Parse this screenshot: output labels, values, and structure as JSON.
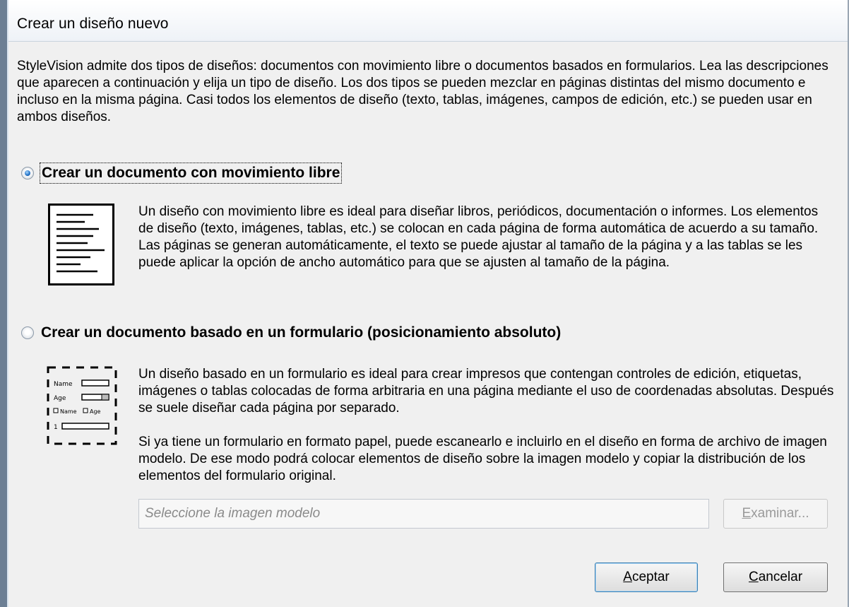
{
  "window": {
    "title": "Crear un diseño nuevo"
  },
  "intro": "StyleVision admite dos tipos de diseños: documentos con movimiento libre o documentos basados en formularios. Lea las descripciones que aparecen a continuación y elija un tipo de diseño. Los dos tipos se pueden mezclar en páginas distintas del mismo documento e incluso en la misma página. Casi todos los elementos de diseño (texto, tablas, imágenes, campos de edición, etc.) se pueden usar en ambos diseños.",
  "options": {
    "free_flow": {
      "label": "Crear un documento con movimiento libre",
      "selected": true,
      "description": "Un diseño con movimiento libre es ideal para diseñar libros, periódicos, documentación o informes. Los elementos de diseño (texto, imágenes, tablas, etc.) se colocan en cada página de forma automática de acuerdo a su tamaño. Las páginas se generan automáticamente, el texto se puede ajustar al tamaño de la página y a las tablas se les puede aplicar la opción de ancho automático para que se ajusten al tamaño de la página.",
      "icon": "document-lines-icon"
    },
    "form_based": {
      "label": "Crear un documento basado en un formulario (posicionamiento absoluto)",
      "selected": false,
      "description1": "Un diseño basado en un formulario es ideal para crear impresos que contengan controles de edición, etiquetas, imágenes o tablas colocadas de forma arbitraria en una página mediante el uso de coordenadas absolutas. Después se suele diseñar cada página por separado.",
      "description2": "Si ya tiene un formulario en formato papel, puede escanearlo e incluirlo en el diseño en forma de archivo de imagen modelo. De ese modo podrá colocar elementos de diseño sobre la imagen modelo y copiar la distribución de los elementos del formulario original.",
      "icon": "form-layout-icon",
      "icon_labels": {
        "name": "Name",
        "age": "Age",
        "check_name": "Name",
        "check_age": "Age",
        "row": "1"
      }
    }
  },
  "template_image": {
    "placeholder": "Seleccione la imagen modelo",
    "value": ""
  },
  "buttons": {
    "browse": {
      "mnemonic": "E",
      "rest": "xaminar...",
      "enabled": false
    },
    "ok": {
      "mnemonic": "A",
      "rest": "ceptar"
    },
    "cancel": {
      "mnemonic": "C",
      "rest": "ancelar"
    }
  },
  "colors": {
    "frame": "#6c7f94",
    "dialog_bg": "#f0f0f0",
    "radio_dot": "#1f6fc4"
  }
}
